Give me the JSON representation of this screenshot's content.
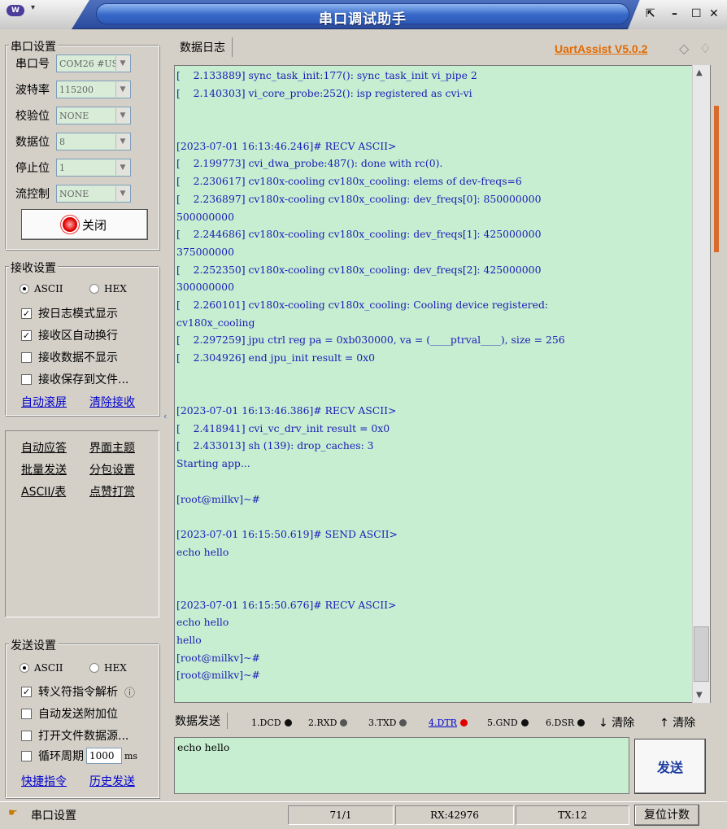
{
  "window": {
    "title": "串口调试助手",
    "app_icon_text": "W",
    "menu_arrow": "▾",
    "controls": {
      "restore": "⇱",
      "minimize": "–",
      "maximize": "☐",
      "close": "✕"
    }
  },
  "serial_settings": {
    "group_title": "串口设置",
    "port": {
      "label": "串口号",
      "value": "COM26 #US"
    },
    "baud": {
      "label": "波特率",
      "value": "115200"
    },
    "parity": {
      "label": "校验位",
      "value": "NONE"
    },
    "databits": {
      "label": "数据位",
      "value": "8"
    },
    "stopbits": {
      "label": "停止位",
      "value": "1"
    },
    "flow": {
      "label": "流控制",
      "value": "NONE"
    },
    "close_button": "关闭"
  },
  "recv_settings": {
    "group_title": "接收设置",
    "ascii": "ASCII",
    "hex": "HEX",
    "options": [
      {
        "label": "按日志模式显示",
        "checked": true
      },
      {
        "label": "接收区自动换行",
        "checked": true
      },
      {
        "label": "接收数据不显示",
        "checked": false
      },
      {
        "label": "接收保存到文件...",
        "checked": false
      }
    ],
    "auto_scroll": "自动滚屏",
    "clear_recv": "清除接收"
  },
  "tools": {
    "auto_reply": "自动应答",
    "theme": "界面主题",
    "batch_send": "批量发送",
    "packet_settings": "分包设置",
    "ascii_table": "ASCII/表",
    "donate": "点赞打赏"
  },
  "send_settings": {
    "group_title": "发送设置",
    "ascii": "ASCII",
    "hex": "HEX",
    "options": [
      {
        "label": "转义符指令解析",
        "checked": true
      },
      {
        "label": "自动发送附加位",
        "checked": false
      },
      {
        "label": "打开文件数据源...",
        "checked": false
      }
    ],
    "cycle_label": "循环周期",
    "cycle_value": "1000",
    "cycle_unit": "ms",
    "shortcuts": "快捷指令",
    "history": "历史发送",
    "info_icon": "ⓘ"
  },
  "log": {
    "tab": "数据日志",
    "brand": "UartAssist V5.0.2",
    "lines": [
      "[    2.133889] sync_task_init:177(): sync_task_init vi_pipe 2",
      "[    2.140303] vi_core_probe:252(): isp registered as cvi-vi",
      "",
      "",
      "[2023-07-01 16:13:46.246]# RECV ASCII>",
      "[    2.199773] cvi_dwa_probe:487(): done with rc(0).",
      "[    2.230617] cv180x-cooling cv180x_cooling: elems of dev-freqs=6",
      "[    2.236897] cv180x-cooling cv180x_cooling: dev_freqs[0]: 850000000",
      "500000000",
      "[    2.244686] cv180x-cooling cv180x_cooling: dev_freqs[1]: 425000000",
      "375000000",
      "[    2.252350] cv180x-cooling cv180x_cooling: dev_freqs[2]: 425000000",
      "300000000",
      "[    2.260101] cv180x-cooling cv180x_cooling: Cooling device registered:",
      "cv180x_cooling",
      "[    2.297259] jpu ctrl reg pa = 0xb030000, va = (____ptrval____), size = 256",
      "[    2.304926] end jpu_init result = 0x0",
      "",
      "",
      "[2023-07-01 16:13:46.386]# RECV ASCII>",
      "[    2.418941] cvi_vc_drv_init result = 0x0",
      "[    2.433013] sh (139): drop_caches: 3",
      "Starting app...",
      "",
      "[root@milkv]~#",
      "",
      "[2023-07-01 16:15:50.619]# SEND ASCII>",
      "echo hello",
      "",
      "",
      "[2023-07-01 16:15:50.676]# RECV ASCII>",
      "echo hello",
      "hello",
      "[root@milkv]~#",
      "[root@milkv]~#"
    ]
  },
  "sendbar": {
    "tab": "数据发送",
    "pins": [
      "1.DCD",
      "2.RXD",
      "3.TXD",
      "4.DTR",
      "5.GND",
      "6.DSR"
    ],
    "clear1": "清除",
    "clear2": "清除",
    "input_value": "echo hello",
    "send_button": "发送"
  },
  "status": {
    "port_settings": "串口设置",
    "pos": "71/1",
    "rx": "RX:42976",
    "tx": "TX:12",
    "reset": "复位计数"
  },
  "colors": {
    "log_bg": "#c7eed0",
    "log_text": "#1b1bb8",
    "brand": "#e36a00",
    "title_bar": "#3768c8"
  }
}
